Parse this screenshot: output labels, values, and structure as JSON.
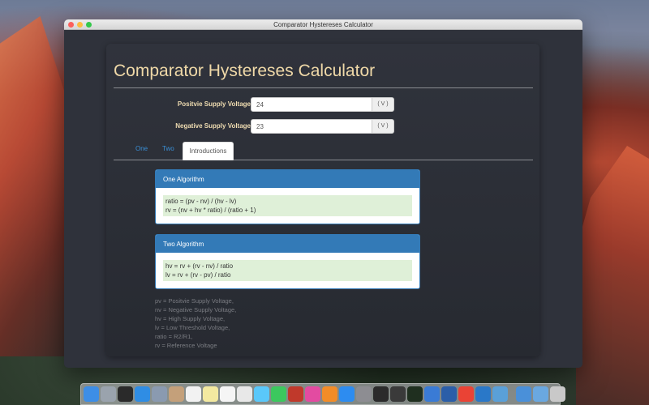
{
  "window": {
    "title": "Comparator Hystereses Calculator"
  },
  "app": {
    "heading": "Comparator Hystereses Calculator",
    "fields": [
      {
        "label": "Positvie Supply Voltage",
        "value": "24",
        "unit": "( V )"
      },
      {
        "label": "Negative Supply Voltage",
        "value": "23",
        "unit": "( V )"
      }
    ],
    "tabs": [
      {
        "label": "One",
        "active": false
      },
      {
        "label": "Two",
        "active": false
      },
      {
        "label": "Introductions",
        "active": true
      }
    ],
    "cards": [
      {
        "title": "One Algorithm",
        "lines": [
          "ratio = (pv - nv) / (hv - lv)",
          "rv = (nv + hv * ratio) / (ratio + 1)"
        ]
      },
      {
        "title": "Two Algorithm",
        "lines": [
          "hv = rv + (rv - nv) / ratio",
          "lv = rv + (rv - pv) / ratio"
        ]
      }
    ],
    "legend": [
      "pv = Positvie Supply Voltage,",
      "nv = Negative Supply Voltage,",
      "hv = High Supply Voltage,",
      "lv = Low Threshold Voltage,",
      "ratio = R2/R1,",
      "rv = Reference Voltage"
    ]
  },
  "dock": {
    "icons": [
      "finder-icon",
      "launchpad-icon",
      "mission-control-icon",
      "safari-icon",
      "preview-icon",
      "contacts-icon",
      "calendar-icon",
      "notes-icon",
      "reminders-icon",
      "photos-icon",
      "messages-icon",
      "facetime-icon",
      "photo-booth-icon",
      "itunes-icon",
      "ibooks-icon",
      "app-store-icon",
      "system-preferences-icon",
      "terminal-icon",
      "console-icon",
      "activity-monitor-icon",
      "xcode-icon",
      "helm-icon",
      "chrome-icon",
      "vscode-icon",
      "simulator-icon",
      "network-icon",
      "downloads-icon",
      "trash-icon"
    ],
    "colors": [
      "#3d8ee6",
      "#9aa3ad",
      "#2a2a2a",
      "#2f8de4",
      "#8a9ab0",
      "#c4a07a",
      "#f2f2f2",
      "#f3e9a0",
      "#f5f5f5",
      "#e8e8e8",
      "#5ac8fa",
      "#3cc85e",
      "#c0392b",
      "#e34ba1",
      "#f28c28",
      "#2d8cf0",
      "#8d8d92",
      "#2b2b2b",
      "#3a3a3a",
      "#1f2f1f",
      "#3a7bd5",
      "#2b5ea8",
      "#ea4335",
      "#2a78c8",
      "#5aa0d8",
      "#4a90d9",
      "#6aa8e0",
      "#c9c9c9"
    ]
  }
}
